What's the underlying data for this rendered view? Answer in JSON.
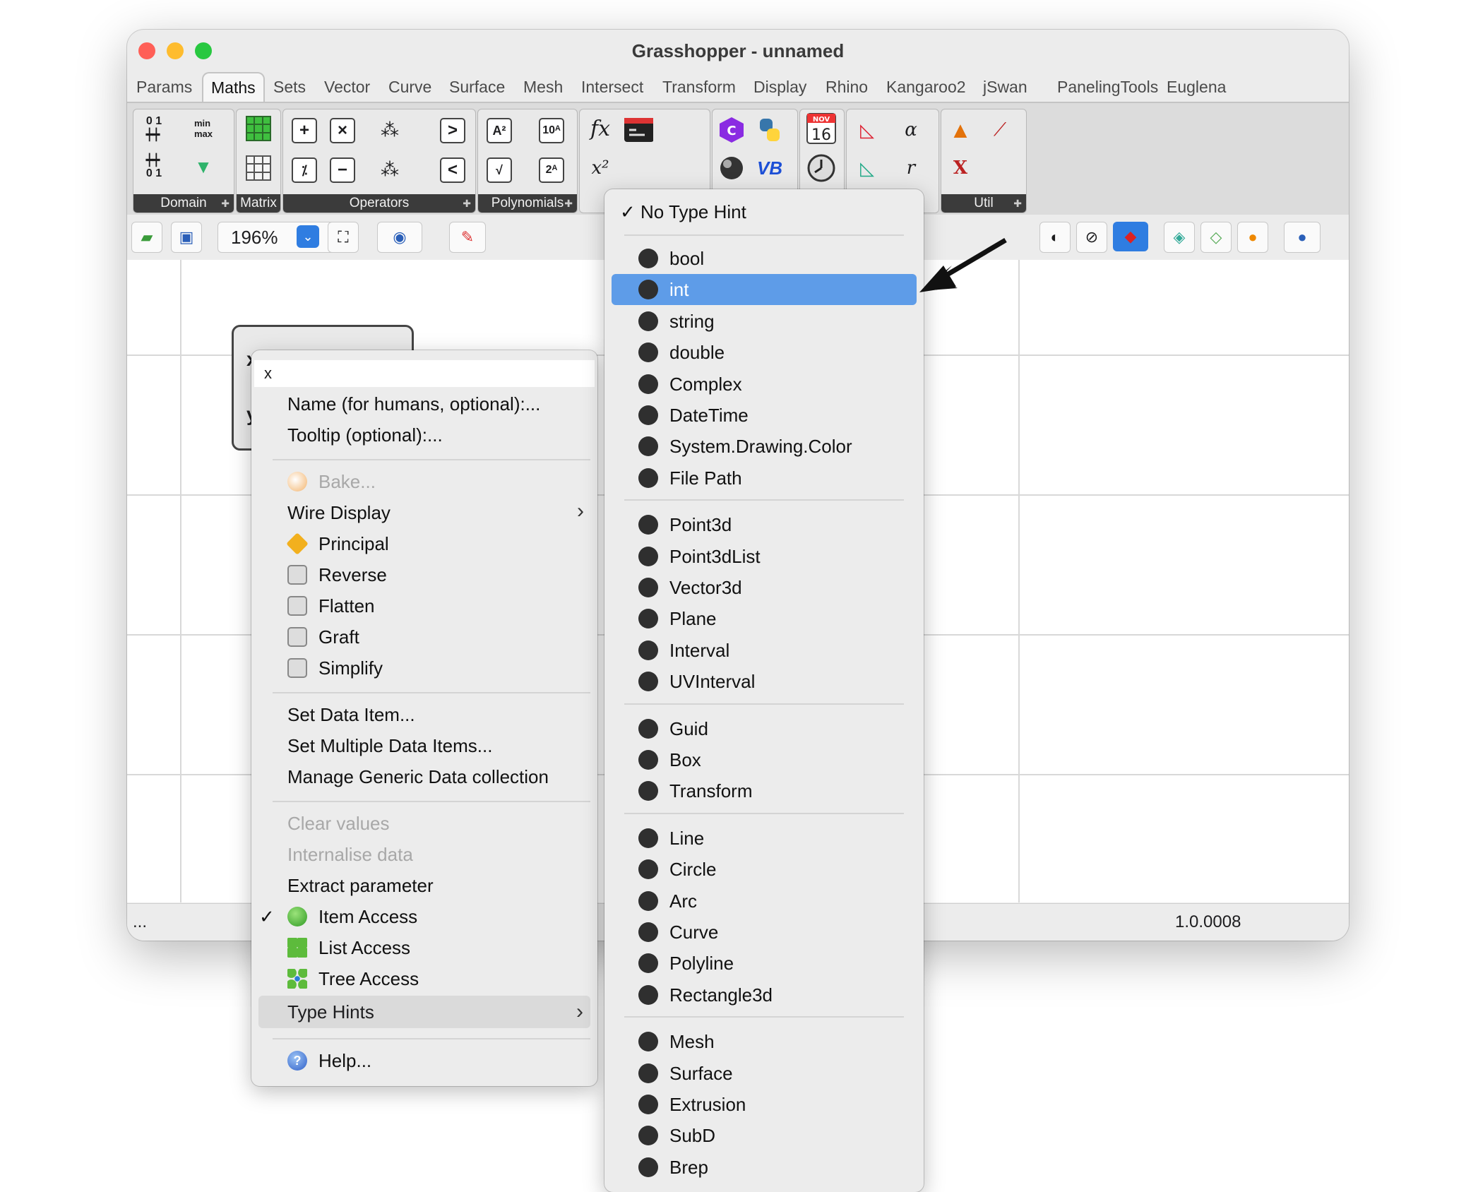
{
  "window": {
    "title": "Grasshopper - unnamed"
  },
  "tabs": [
    "Params",
    "Maths",
    "Sets",
    "Vector",
    "Curve",
    "Surface",
    "Mesh",
    "Intersect",
    "Transform",
    "Display",
    "Rhino",
    "Kangaroo2",
    "jSwan",
    "PanelingTools",
    "Euglena"
  ],
  "ribbon": {
    "groups": {
      "domain": "Domain",
      "matrix": "Matrix",
      "operators": "Operators",
      "polynomials": "Polynomials",
      "util": "Util"
    },
    "calendar_month": "NOV",
    "calendar_day": "16"
  },
  "toolbar": {
    "zoom": "196%"
  },
  "status": {
    "left": "...",
    "version": "1.0.0008"
  },
  "component": {
    "input_x": "x",
    "input_y": "y"
  },
  "context_menu": {
    "name_field": "x",
    "name_label": "Name (for humans, optional):...",
    "tooltip_label": "Tooltip (optional):...",
    "bake": "Bake...",
    "wire_display": "Wire Display",
    "principal": "Principal",
    "reverse": "Reverse",
    "flatten": "Flatten",
    "graft": "Graft",
    "simplify": "Simplify",
    "set_data_item": "Set Data Item...",
    "set_multiple": "Set Multiple Data Items...",
    "manage_generic": "Manage Generic Data collection",
    "clear_values": "Clear values",
    "internalise": "Internalise data",
    "extract": "Extract parameter",
    "item_access": "Item Access",
    "list_access": "List Access",
    "tree_access": "Tree Access",
    "type_hints": "Type Hints",
    "help": "Help...",
    "checkmark": "✓"
  },
  "type_hints": {
    "no_hint": "No Type Hint",
    "checkmark": "✓",
    "selected": "int",
    "groups": [
      [
        "bool",
        "int",
        "string",
        "double",
        "Complex",
        "DateTime",
        "System.Drawing.Color",
        "File Path"
      ],
      [
        "Point3d",
        "Point3dList",
        "Vector3d",
        "Plane",
        "Interval",
        "UVInterval"
      ],
      [
        "Guid",
        "Box",
        "Transform"
      ],
      [
        "Line",
        "Circle",
        "Arc",
        "Curve",
        "Polyline",
        "Rectangle3d"
      ],
      [
        "Mesh",
        "Surface",
        "Extrusion",
        "SubD",
        "Brep"
      ]
    ]
  },
  "colors": {
    "highlight": "#5e9ce8",
    "close": "#ff5f57",
    "minimize": "#febc2e",
    "zoom": "#28c840"
  }
}
